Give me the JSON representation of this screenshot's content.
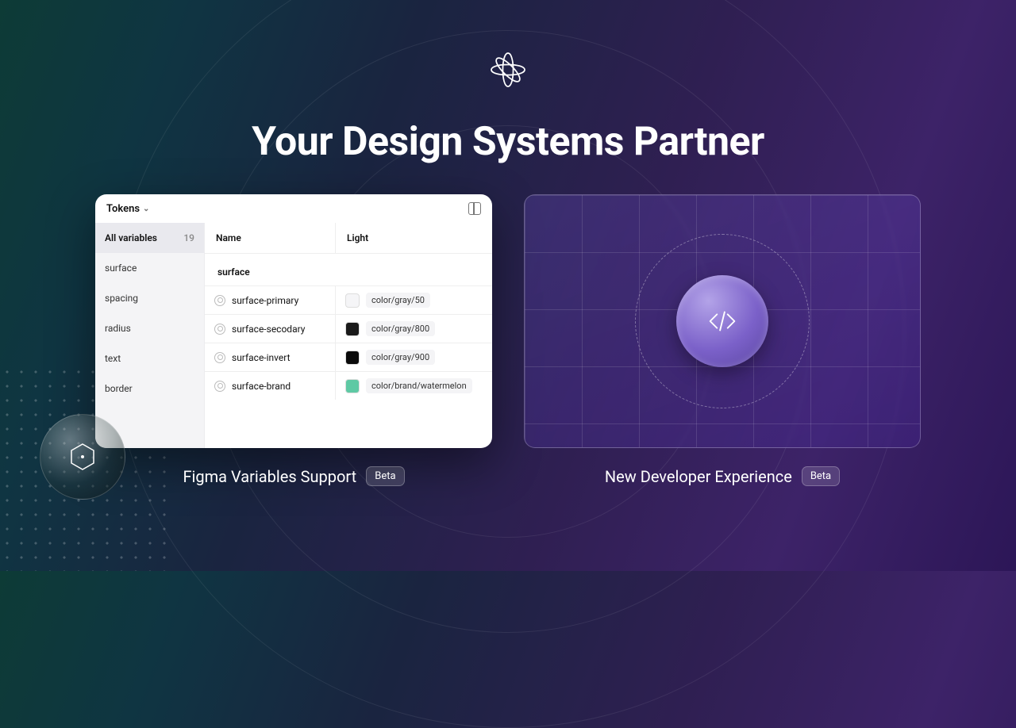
{
  "headline": "Your Design Systems Partner",
  "tokensPanel": {
    "dropdownLabel": "Tokens",
    "allVariablesLabel": "All variables",
    "allVariablesCount": "19",
    "categories": [
      "surface",
      "spacing",
      "radius",
      "text",
      "border"
    ],
    "columns": {
      "name": "Name",
      "light": "Light"
    },
    "sectionLabel": "surface",
    "rows": [
      {
        "name": "surface-primary",
        "swatch": "#f5f5f7",
        "alias": "color/gray/50"
      },
      {
        "name": "surface-secodary",
        "swatch": "#1a1a1a",
        "alias": "color/gray/800"
      },
      {
        "name": "surface-invert",
        "swatch": "#0a0a0a",
        "alias": "color/gray/900"
      },
      {
        "name": "surface-brand",
        "swatch": "#5ec9a4",
        "alias": "color/brand/watermelon"
      }
    ]
  },
  "captions": {
    "left": {
      "text": "Figma Variables Support",
      "badge": "Beta"
    },
    "right": {
      "text": "New Developer Experience",
      "badge": "Beta"
    }
  }
}
